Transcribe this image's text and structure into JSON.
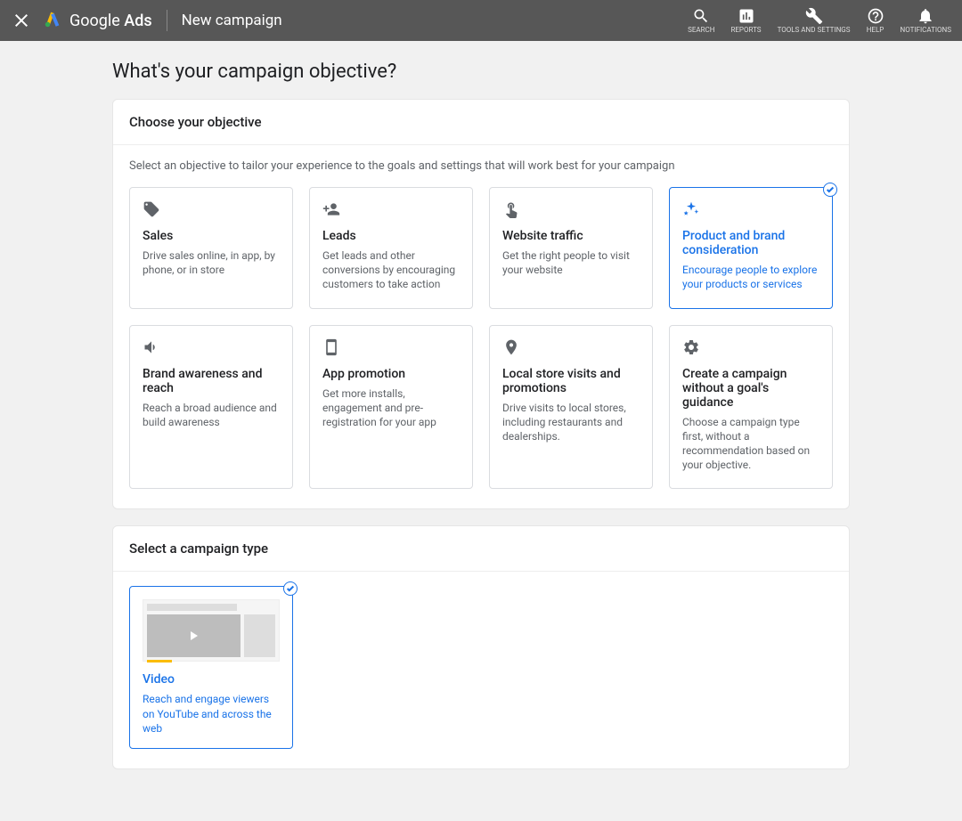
{
  "header": {
    "brand_prefix": "Google",
    "brand_suffix": "Ads",
    "page_title": "New campaign",
    "nav": {
      "search": "Search",
      "reports": "Reports",
      "tools": "Tools and Settings",
      "help": "Help",
      "notifications": "Notifications"
    }
  },
  "question": "What's your campaign objective?",
  "objective_panel": {
    "title": "Choose your objective",
    "subtitle": "Select an objective to tailor your experience to the goals and settings that will work best for your campaign",
    "cards": {
      "sales": {
        "title": "Sales",
        "desc": "Drive sales online, in app, by phone, or in store"
      },
      "leads": {
        "title": "Leads",
        "desc": "Get leads and other conversions by encouraging customers to take action"
      },
      "traffic": {
        "title": "Website traffic",
        "desc": "Get the right people to visit your website"
      },
      "brand_consideration": {
        "title": "Product and brand consideration",
        "desc": "Encourage people to explore your products or services"
      },
      "awareness": {
        "title": "Brand awareness and reach",
        "desc": "Reach a broad audience and build awareness"
      },
      "app": {
        "title": "App promotion",
        "desc": "Get more installs, engagement and pre-registration for your app"
      },
      "local": {
        "title": "Local store visits and promotions",
        "desc": "Drive visits to local stores, including restaurants and dealerships."
      },
      "none": {
        "title": "Create a campaign without a goal's guidance",
        "desc": "Choose a campaign type first, without a recommendation based on your objective."
      }
    },
    "selected": "brand_consideration"
  },
  "type_panel": {
    "title": "Select a campaign type",
    "cards": {
      "video": {
        "title": "Video",
        "desc": "Reach and engage viewers on YouTube and across the web"
      }
    },
    "selected": "video"
  }
}
